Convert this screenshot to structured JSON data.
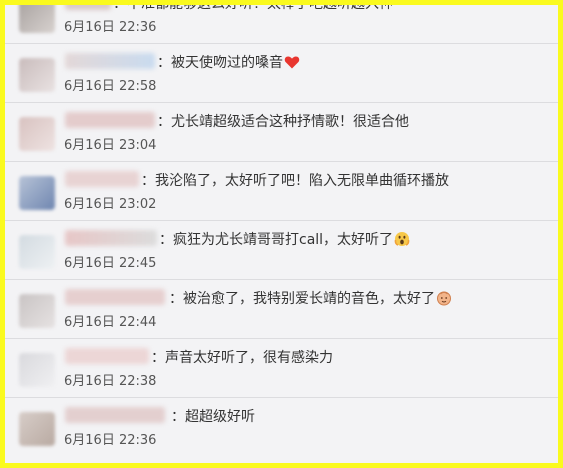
{
  "comments": [
    {
      "text": "：不准都能够这么好听！太棒了吧越听越入神",
      "time": "6月16日 22:36",
      "emoji": ""
    },
    {
      "text": "：被天使吻过的嗓音",
      "time": "6月16日 22:58",
      "emoji": "heart-emoji"
    },
    {
      "text": "：尤长靖超级适合这种抒情歌！很适合他",
      "time": "6月16日 23:04",
      "emoji": ""
    },
    {
      "text": "：我沦陷了，太好听了吧！陷入无限单曲循环播放",
      "time": "6月16日 23:02",
      "emoji": ""
    },
    {
      "text": "：疯狂为尤长靖哥哥打call，太好听了",
      "time": "6月16日 22:45",
      "emoji": "scream-face-emoji"
    },
    {
      "text": "：被治愈了，我特别爱长靖的音色，太好了",
      "time": "6月16日 22:44",
      "emoji": "face-emoji"
    },
    {
      "text": "：声音太好听了，很有感染力",
      "time": "6月16日 22:38",
      "emoji": ""
    },
    {
      "text": "：超超级好听",
      "time": "6月16日 22:36",
      "emoji": ""
    }
  ],
  "colors": {
    "frame_border": "#fafa1e",
    "background": "#f3f3f5",
    "heart": "#e8362f"
  }
}
